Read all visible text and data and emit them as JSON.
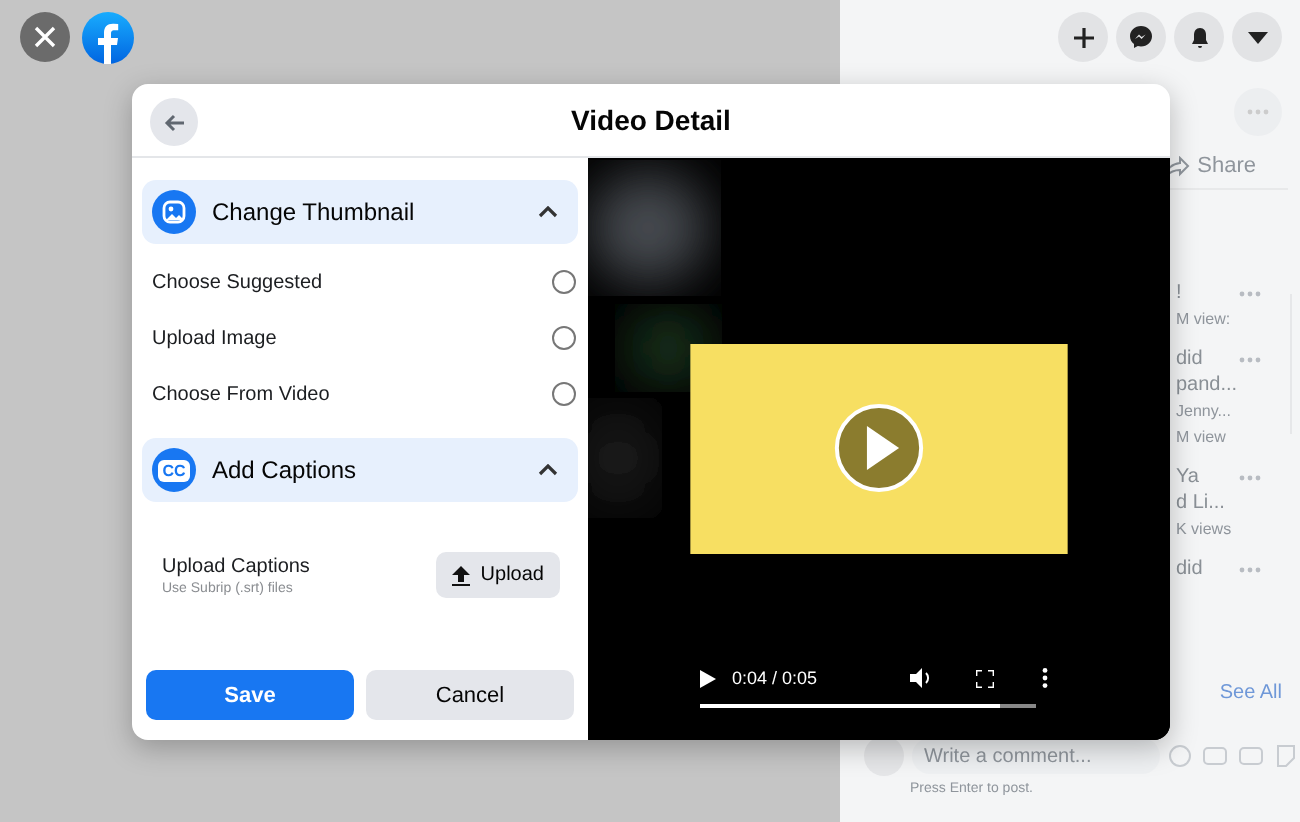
{
  "modal": {
    "title": "Video Detail",
    "sections": [
      {
        "title": "Change Thumbnail",
        "expanded": true,
        "options": [
          {
            "label": "Choose Suggested",
            "selected": false
          },
          {
            "label": "Upload Image",
            "selected": false
          },
          {
            "label": "Choose From Video",
            "selected": false
          }
        ]
      },
      {
        "title": "Add Captions",
        "icon_text": "CC",
        "expanded": true,
        "upload": {
          "label": "Upload Captions",
          "hint": "Use Subrip (.srt) files",
          "button": "Upload"
        }
      }
    ],
    "buttons": [
      {
        "label": "Save",
        "kind": "primary"
      },
      {
        "label": "Cancel",
        "kind": "secondary"
      }
    ]
  },
  "player": {
    "time": "0:04 / 0:05",
    "level": 0.89
  },
  "side_panel": {
    "share": "Share",
    "feed": [
      {
        "lines": [
          "!"
        ],
        "meta": [
          "M view:"
        ]
      },
      {
        "lines": [
          "did",
          "pand..."
        ],
        "meta": [
          "Jenny...",
          "M view"
        ]
      },
      {
        "lines": [
          "Ya",
          "d Li..."
        ],
        "meta": [
          "K views"
        ]
      },
      {
        "lines": [
          "did"
        ]
      }
    ],
    "see_all": "See All",
    "comment": {
      "placeholder": "Write a comment...",
      "hint": "Press Enter to post."
    }
  }
}
